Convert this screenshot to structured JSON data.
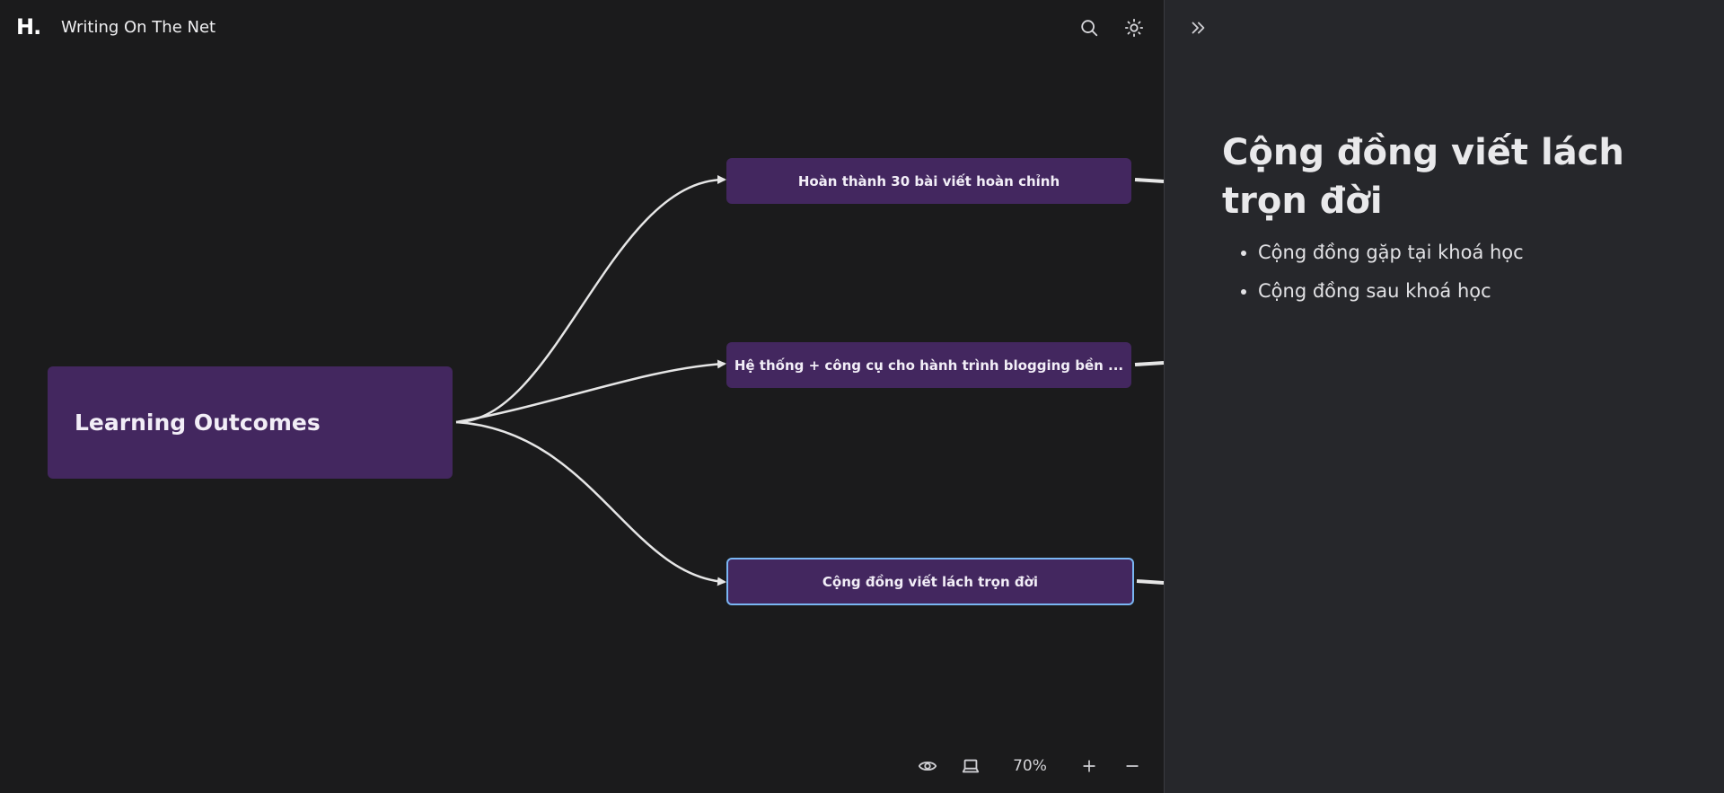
{
  "app": {
    "logo": "H.",
    "title": "Writing On The Net"
  },
  "toolbar": {
    "search_icon": "search-icon",
    "theme_icon": "sun-icon"
  },
  "mindmap": {
    "root": {
      "label": "Learning Outcomes"
    },
    "children": [
      {
        "label": "Hoàn thành 30 bài viết hoàn chỉnh",
        "selected": false
      },
      {
        "label": "Hệ thống + công cụ cho hành trình blogging bền ...",
        "selected": false
      },
      {
        "label": "Cộng đồng viết lách trọn đời",
        "selected": true
      }
    ]
  },
  "bottom_controls": {
    "preview_icon": "eye-icon",
    "layout_icon": "laptop-icon",
    "zoom": "70%",
    "zoom_in_icon": "plus-icon",
    "zoom_out_icon": "minus-icon"
  },
  "panel": {
    "collapse_icon": "chevrons-right-icon",
    "title": "Cộng đồng viết lách trọn đời",
    "items": [
      "Cộng đồng gặp tại khoá học",
      "Cộng đồng sau khoá học"
    ]
  },
  "colors": {
    "canvas_bg": "#1b1b1c",
    "panel_bg": "#26272b",
    "node_bg": "#43275f",
    "selected_border": "#7ab6f3",
    "edge": "#e6e6e6"
  }
}
